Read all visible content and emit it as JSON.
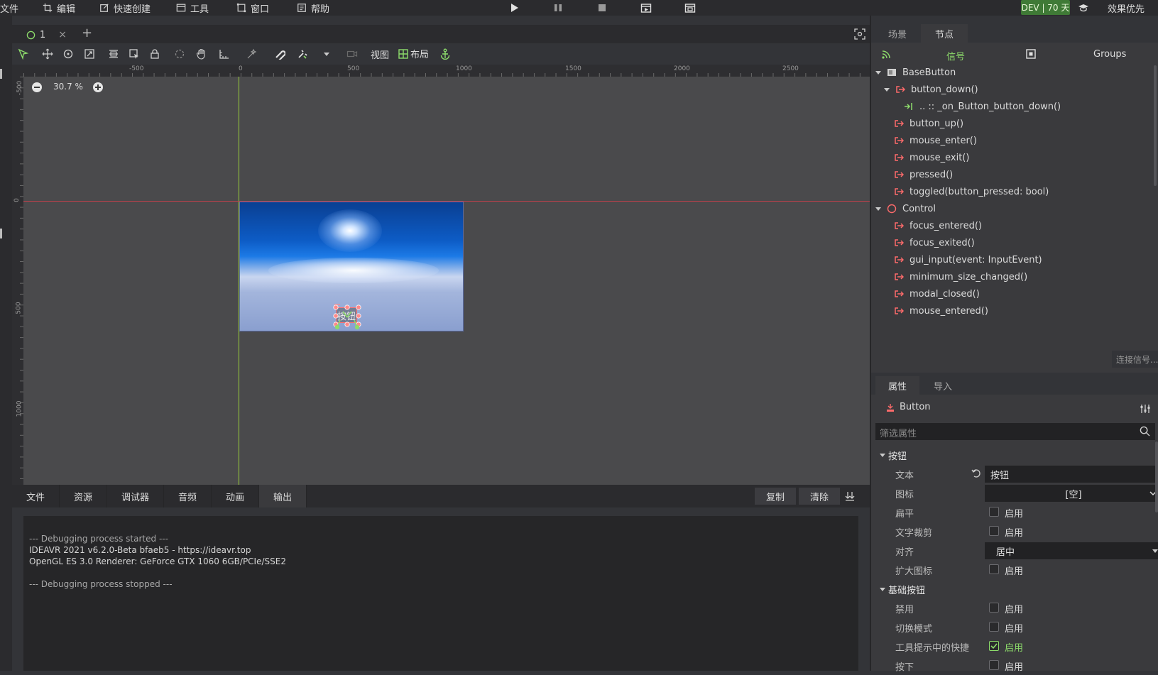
{
  "menu": {
    "file": "文件",
    "edit": "编辑",
    "quick_create": "快速创建",
    "tools": "工具",
    "window": "窗口",
    "help": "帮助",
    "dev_badge": "DEV | 70 天",
    "effect_priority": "效果优先"
  },
  "scene_tab": {
    "name": "1"
  },
  "toolbar": {
    "view_label": "视图",
    "layout_label": "布局"
  },
  "viewport": {
    "zoom_text": "30.7 %",
    "ruler_top": [
      "-500",
      "0",
      "500",
      "1000",
      "1500",
      "2000",
      "2500"
    ],
    "ruler_left": [
      "-500",
      "0",
      "500",
      "1000"
    ],
    "button_text": "按钮"
  },
  "bottom_panel": {
    "tabs": [
      "文件",
      "资源",
      "调试器",
      "音频",
      "动画",
      "输出"
    ],
    "active_tab": "输出",
    "copy_label": "复制",
    "clear_label": "清除",
    "output_lines": [
      "--- Debugging process started ---",
      "IDEAVR 2021 v6.2.0-Beta bfaeb5 - https://ideavr.top",
      "OpenGL ES 3.0 Renderer: GeForce GTX 1060 6GB/PCIe/SSE2",
      "",
      "--- Debugging process stopped ---"
    ]
  },
  "dock_top": {
    "tabs": [
      "场景",
      "节点"
    ],
    "active_tab": "节点",
    "subtabs": {
      "signals": "信号",
      "groups": "Groups"
    },
    "tree": [
      {
        "label": "BaseButton",
        "kind": "class"
      },
      {
        "label": "button_down()",
        "kind": "signal-expanded"
      },
      {
        "label": ".. :: _on_Button_button_down()",
        "kind": "connection"
      },
      {
        "label": "button_up()",
        "kind": "signal"
      },
      {
        "label": "mouse_enter()",
        "kind": "signal"
      },
      {
        "label": "mouse_exit()",
        "kind": "signal"
      },
      {
        "label": "pressed()",
        "kind": "signal"
      },
      {
        "label": "toggled(button_pressed: bool)",
        "kind": "signal"
      },
      {
        "label": "Control",
        "kind": "class"
      },
      {
        "label": "focus_entered()",
        "kind": "signal"
      },
      {
        "label": "focus_exited()",
        "kind": "signal"
      },
      {
        "label": "gui_input(event: InputEvent)",
        "kind": "signal"
      },
      {
        "label": "minimum_size_changed()",
        "kind": "signal"
      },
      {
        "label": "modal_closed()",
        "kind": "signal"
      },
      {
        "label": "mouse_entered()",
        "kind": "signal"
      }
    ],
    "connect_button": "连接信号..."
  },
  "dock_bottom": {
    "tabs": [
      "属性",
      "导入"
    ],
    "active_tab": "属性",
    "node_name": "Button",
    "filter_placeholder": "筛选属性",
    "sections": {
      "button": "按钮",
      "base_button": "基础按钮"
    },
    "props": {
      "text_label": "文本",
      "text_value": "按钮",
      "icon_label": "图标",
      "icon_value": "[空]",
      "flat_label": "扁平",
      "clip_text_label": "文字裁剪",
      "align_label": "对齐",
      "align_value": "居中",
      "expand_icon_label": "扩大图标",
      "disabled_label": "禁用",
      "toggle_mode_label": "切换模式",
      "shortcut_tooltip_label": "工具提示中的快捷",
      "pressed_label": "按下",
      "enable_label": "启用"
    }
  },
  "colors": {
    "accent": "#8ddc6b",
    "signal": "#ff6b6b",
    "dev_badge": "#3f7a36"
  }
}
